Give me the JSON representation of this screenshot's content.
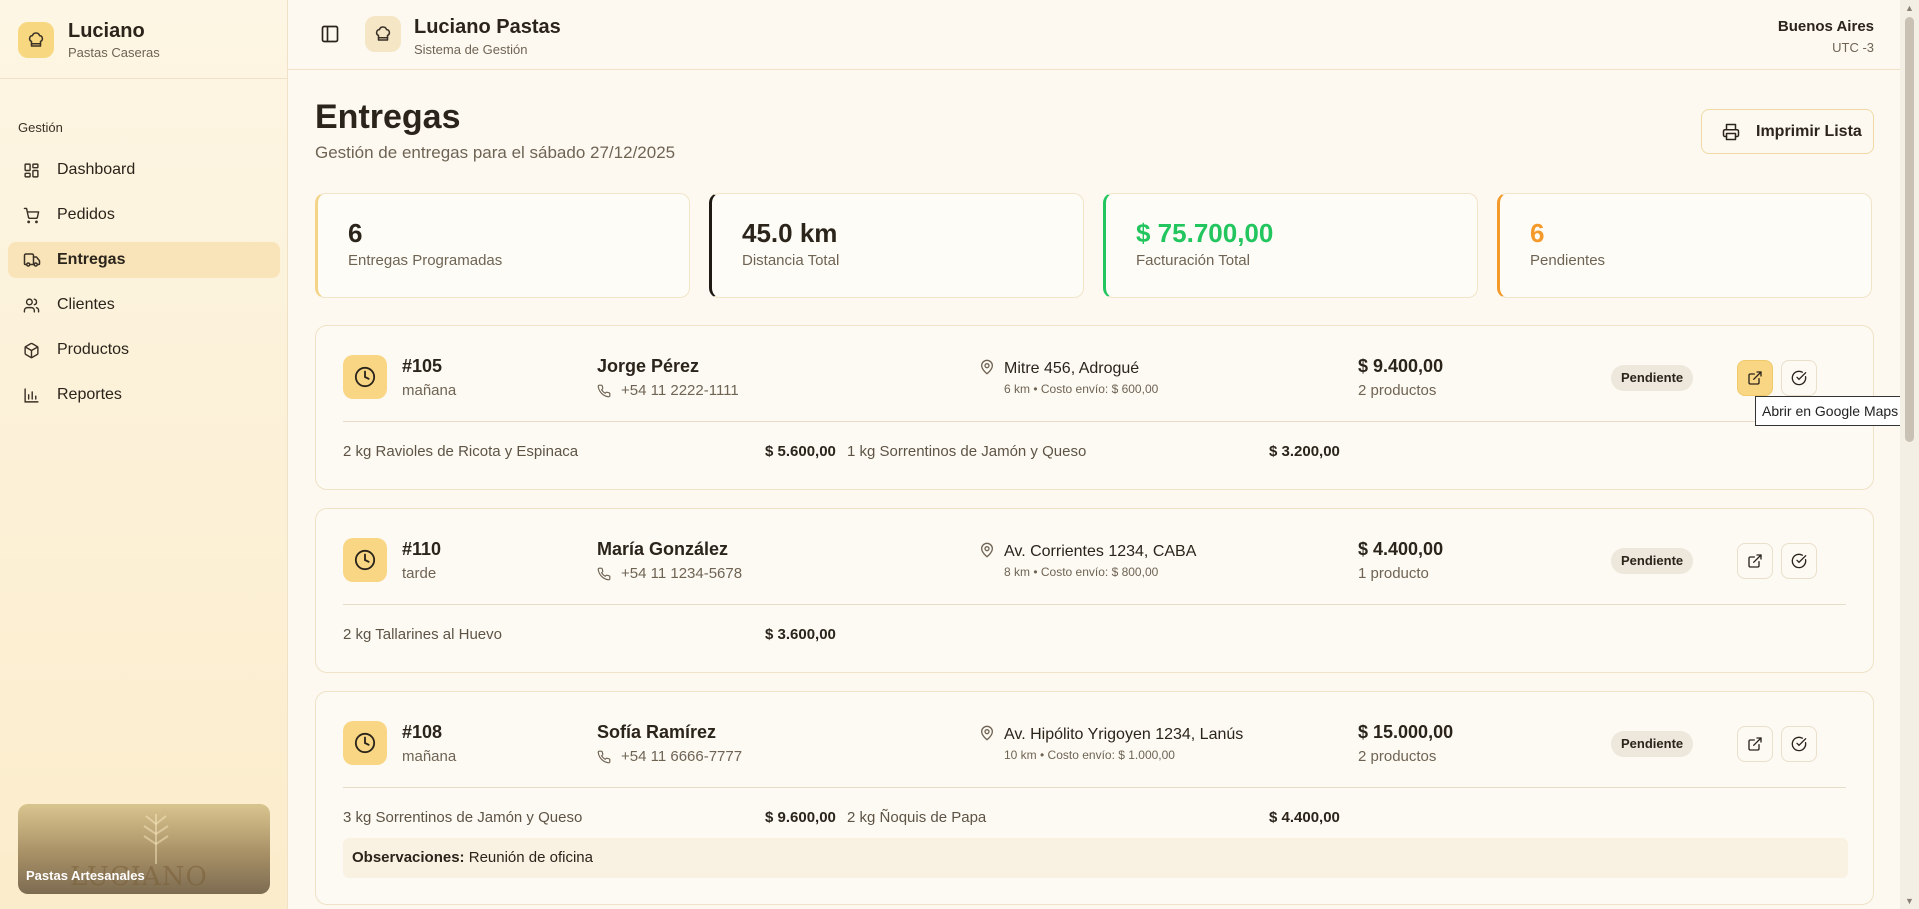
{
  "sidebar": {
    "brand_title": "Luciano",
    "brand_subtitle": "Pastas Caseras",
    "group_label": "Gestión",
    "items": [
      {
        "label": "Dashboard",
        "icon": "dashboard-icon"
      },
      {
        "label": "Pedidos",
        "icon": "cart-icon"
      },
      {
        "label": "Entregas",
        "icon": "truck-icon",
        "active": true
      },
      {
        "label": "Clientes",
        "icon": "users-icon"
      },
      {
        "label": "Productos",
        "icon": "box-icon"
      },
      {
        "label": "Reportes",
        "icon": "bar-chart-icon"
      }
    ],
    "promo_label": "Pastas Artesanales",
    "promo_watermark": "LUCIANO"
  },
  "header": {
    "title": "Luciano Pastas",
    "subtitle": "Sistema de Gestión",
    "tz_city": "Buenos Aires",
    "tz_offset": "UTC -3"
  },
  "page": {
    "title": "Entregas",
    "subtitle": "Gestión de entregas para el sábado 27/12/2025",
    "print_label": "Imprimir Lista"
  },
  "stats": [
    {
      "value": "6",
      "label": "Entregas Programadas",
      "accent": "#f3d489",
      "value_color": "#2b241b"
    },
    {
      "value": "45.0 km",
      "label": "Distancia Total",
      "accent": "#1f1a14",
      "value_color": "#2b241b"
    },
    {
      "value": "$ 75.700,00",
      "label": "Facturación Total",
      "accent": "#22c55e",
      "value_color": "#22c55e"
    },
    {
      "value": "6",
      "label": "Pendientes",
      "accent": "#f39a2b",
      "value_color": "#f39a2b"
    }
  ],
  "deliveries": [
    {
      "id": "#105",
      "slot": "mañana",
      "client": "Jorge Pérez",
      "phone": "+54 11 2222-1111",
      "address": "Mitre 456, Adrogué",
      "meta": "6 km • Costo envío: $ 600,00",
      "total": "$ 9.400,00",
      "count": "2 productos",
      "status": "Pendiente",
      "items": [
        {
          "name": "2 kg Ravioles de Ricota y Espinaca",
          "price": "$ 5.600,00"
        },
        {
          "name": "1 kg Sorrentinos de Jamón y Queso",
          "price": "$ 3.200,00"
        }
      ]
    },
    {
      "id": "#110",
      "slot": "tarde",
      "client": "María González",
      "phone": "+54 11 1234-5678",
      "address": "Av. Corrientes 1234, CABA",
      "meta": "8 km • Costo envío: $ 800,00",
      "total": "$ 4.400,00",
      "count": "1 producto",
      "status": "Pendiente",
      "items": [
        {
          "name": "2 kg Tallarines al Huevo",
          "price": "$ 3.600,00"
        }
      ]
    },
    {
      "id": "#108",
      "slot": "mañana",
      "client": "Sofía Ramírez",
      "phone": "+54 11 6666-7777",
      "address": "Av. Hipólito Yrigoyen 1234, Lanús",
      "meta": "10 km • Costo envío: $ 1.000,00",
      "total": "$ 15.000,00",
      "count": "2 productos",
      "status": "Pendiente",
      "items": [
        {
          "name": "3 kg Sorrentinos de Jamón y Queso",
          "price": "$ 9.600,00"
        },
        {
          "name": "2 kg Ñoquis de Papa",
          "price": "$ 4.400,00"
        }
      ],
      "obs_label": "Observaciones:",
      "obs_text": "Reunión de oficina"
    }
  ],
  "tooltip": "Abrir en Google Maps"
}
